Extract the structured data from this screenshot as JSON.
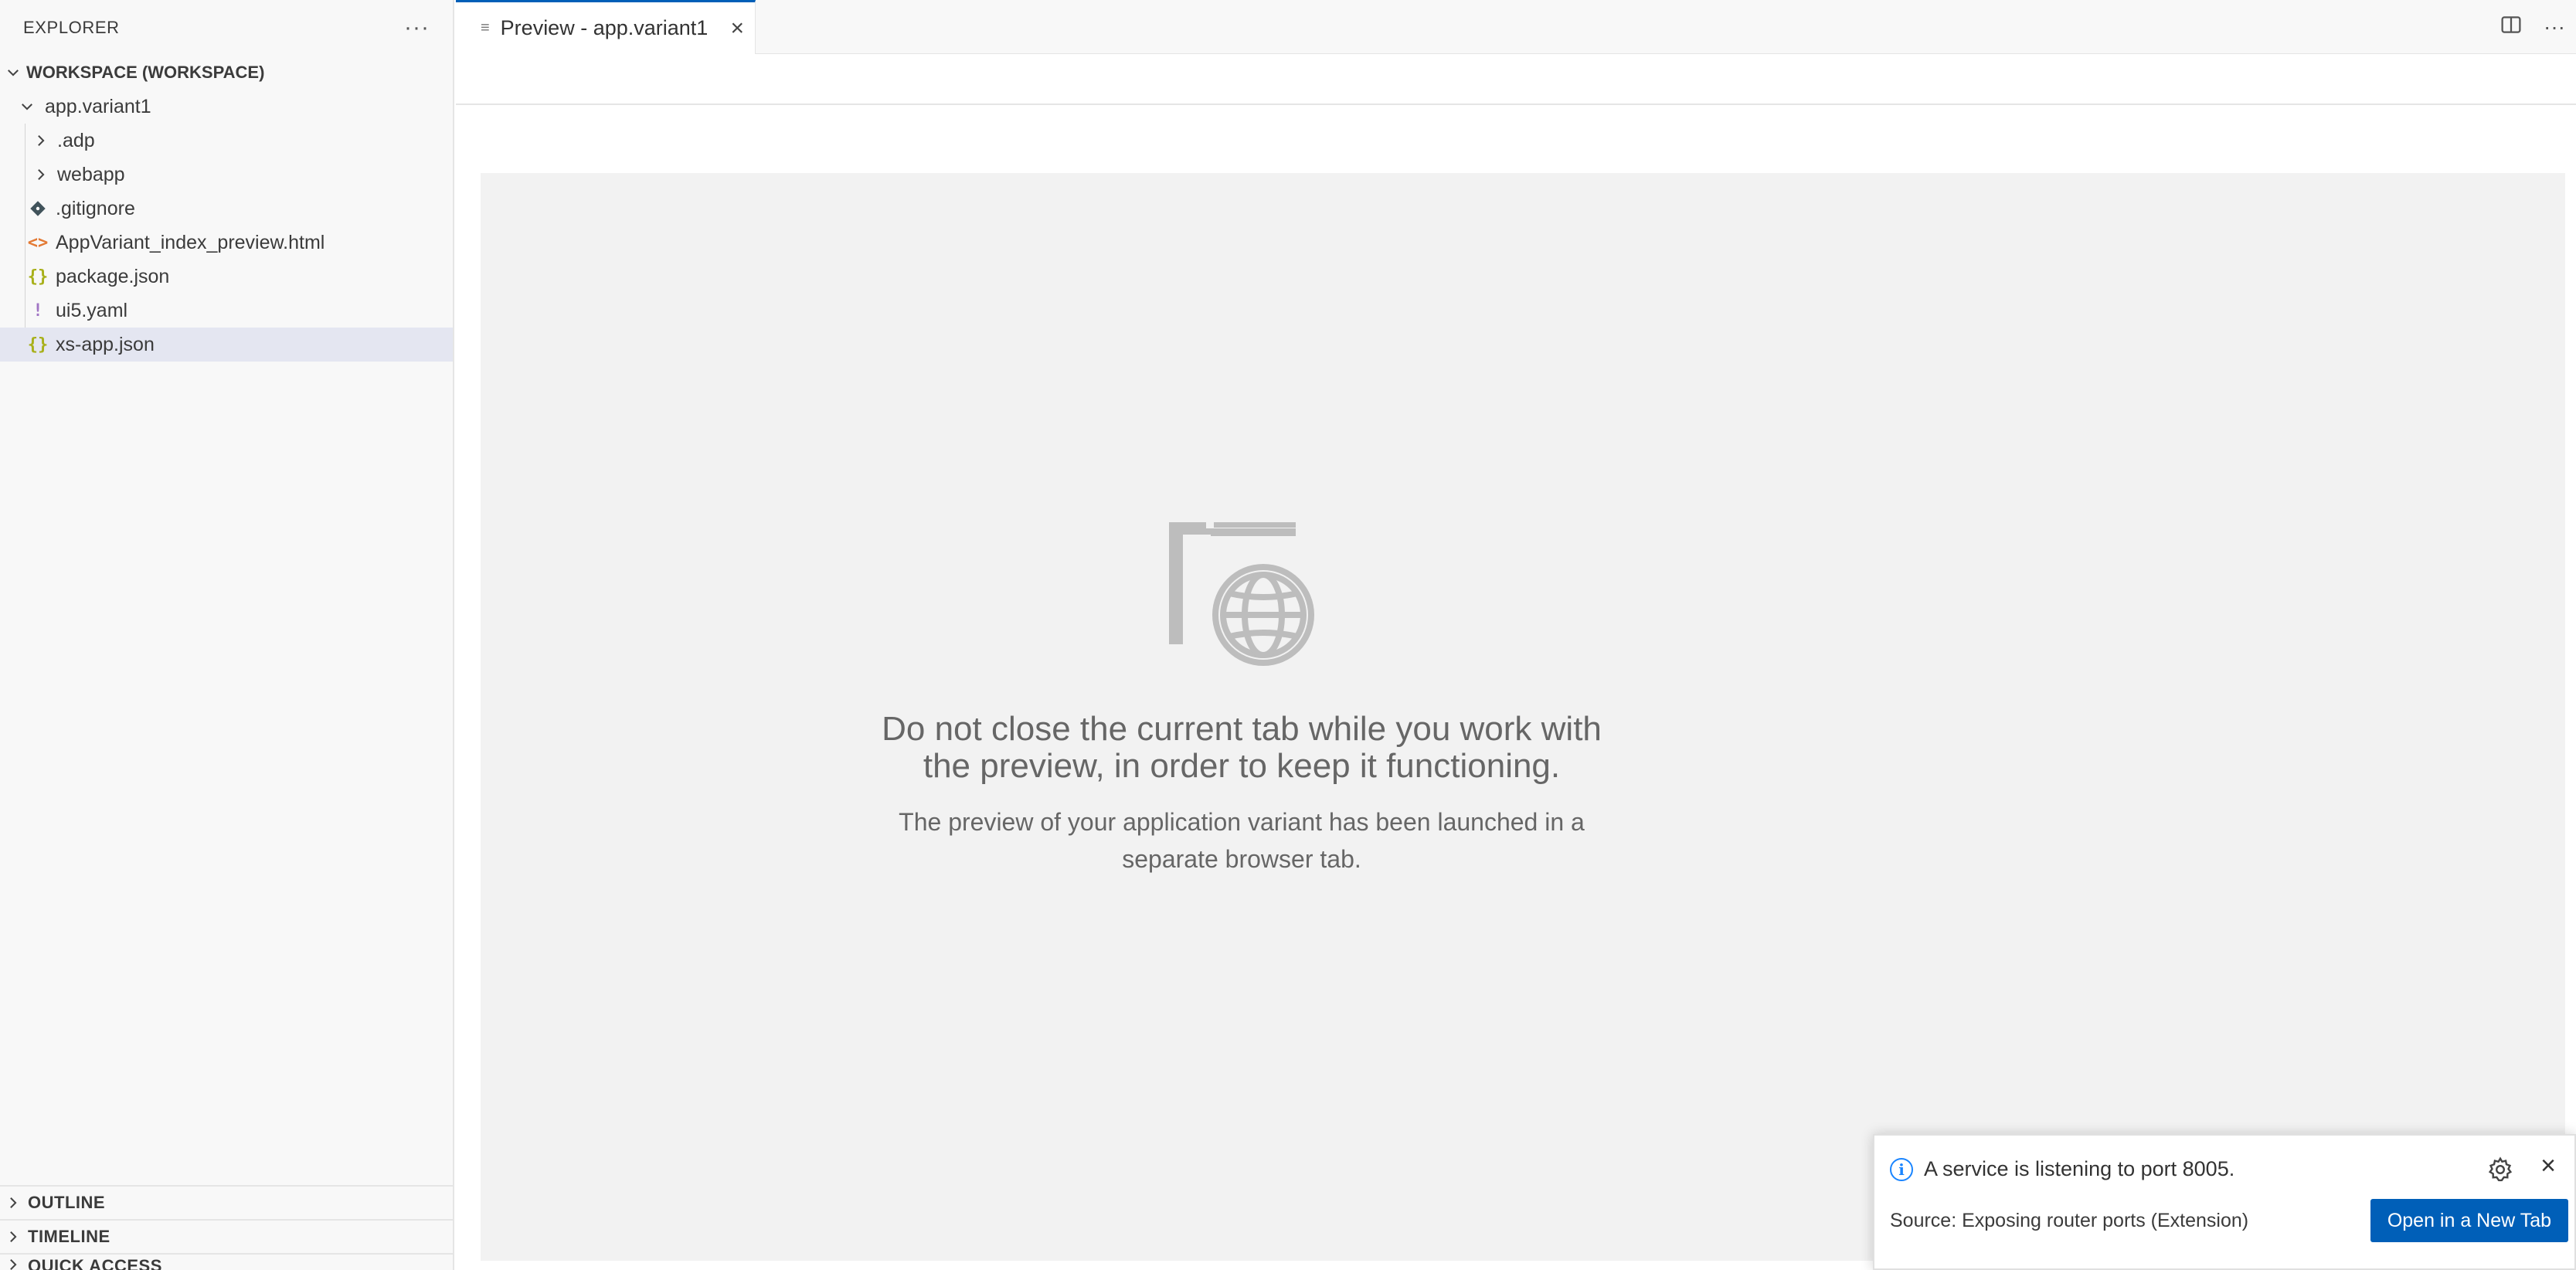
{
  "sidebar": {
    "title": "EXPLORER",
    "more_icon": "ellipsis-icon",
    "workspace_label": "WORKSPACE (WORKSPACE)",
    "tree": [
      {
        "label": "app.variant1",
        "kind": "folder-open"
      },
      {
        "label": ".adp",
        "kind": "folder-closed"
      },
      {
        "label": "webapp",
        "kind": "folder-closed"
      },
      {
        "label": ".gitignore",
        "kind": "gitignore",
        "icon_color": "#41535b"
      },
      {
        "label": "AppVariant_index_preview.html",
        "kind": "html",
        "icon_color": "#e37933"
      },
      {
        "label": "package.json",
        "kind": "json",
        "icon_color": "#a8b01a"
      },
      {
        "label": "ui5.yaml",
        "kind": "yaml",
        "icon_color": "#a074c4"
      },
      {
        "label": "xs-app.json",
        "kind": "json",
        "icon_color": "#a8b01a",
        "selected": true
      }
    ],
    "sections": [
      {
        "label": "OUTLINE"
      },
      {
        "label": "TIMELINE"
      },
      {
        "label": "QUICK ACCESS"
      }
    ]
  },
  "editor": {
    "tab": {
      "label": "Preview - app.variant1",
      "icon": "preview-file-icon"
    },
    "actions": {
      "split": "split-editor-icon",
      "more": "ellipsis-icon"
    }
  },
  "preview": {
    "illustration": "folder-globe-icon",
    "title": "Do not close the current tab while you work with the preview, in order to keep it functioning.",
    "text": "The preview of your application variant has been launched in a separate browser tab."
  },
  "notification": {
    "message": "A service is listening to port 8005.",
    "source": "Source: Exposing router ports (Extension)",
    "button_label": "Open in a New Tab",
    "accent": "#005fb8",
    "info_color": "#1a85ff"
  }
}
